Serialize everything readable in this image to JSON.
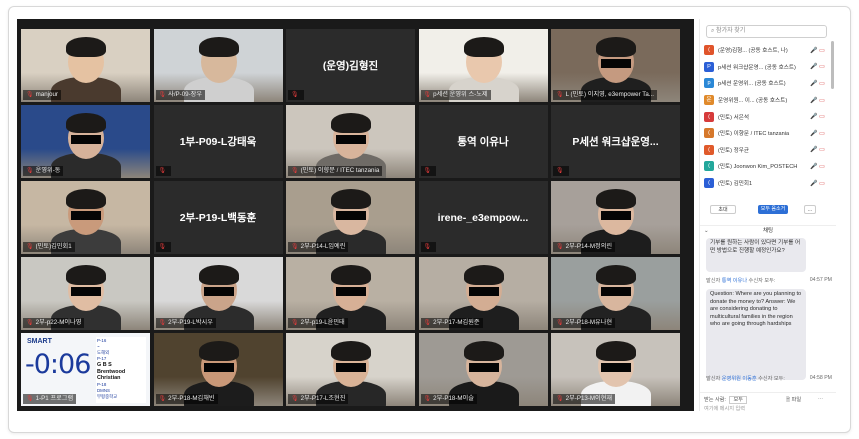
{
  "tiles": [
    {
      "label": "manjour",
      "mic": "on"
    },
    {
      "label": "사/P-09-장우",
      "mic": "off"
    },
    {
      "label": "",
      "center": "(운영)김형진",
      "mic": "off"
    },
    {
      "label": "p세션 운영위 스-노제",
      "mic": "off",
      "active": true
    },
    {
      "label": "L (민토) 이지영, e3empower Ta...",
      "mic": "off"
    },
    {
      "label": "운영위-동",
      "mic": "off"
    },
    {
      "label": "",
      "center": "1부-P09-L강태욱",
      "mic": "off"
    },
    {
      "label": "(민토) 이향문 / ITEC tanzania",
      "mic": "off"
    },
    {
      "label": "",
      "center": "통역 이유나",
      "mic": "off"
    },
    {
      "label": "",
      "center": "P세션 워크샵운영...",
      "mic": "off"
    },
    {
      "label": "(민토)김민회1",
      "mic": "off"
    },
    {
      "label": "",
      "center": "2부-P19-L백동훈",
      "mic": "off"
    },
    {
      "label": "2부-P14-L임예린",
      "mic": "off"
    },
    {
      "label": "",
      "center": "irene-_e3empow...",
      "mic": "off"
    },
    {
      "label": "2부-P14-M정의린",
      "mic": "off"
    },
    {
      "label": "2부-p22-M이나영",
      "mic": "off"
    },
    {
      "label": "2부-P19-L박시우",
      "mic": "off"
    },
    {
      "label": "2부-p19-L윤민태",
      "mic": "off"
    },
    {
      "label": "2부-P17-M김원준",
      "mic": "off"
    },
    {
      "label": "2부-P18-M유나현",
      "mic": "off"
    },
    {
      "label": "1-P1 프로그램",
      "mic": "off",
      "timer": true
    },
    {
      "label": "2부-P18-M김채빈",
      "mic": "off"
    },
    {
      "label": "2부-P17-L조현진",
      "mic": "off"
    },
    {
      "label": "2부-P18-M이슬",
      "mic": "off"
    },
    {
      "label": "2부-P13-M이현재",
      "mic": "off"
    }
  ],
  "timer": {
    "brand": "SMART",
    "countdown": "-0:06",
    "side_lines": [
      "P-16",
      "~",
      "도해외",
      "P-17",
      "G B S",
      "Brentwood Christian",
      "P-18",
      "DMNS",
      "부평중학교"
    ]
  },
  "panel": {
    "search_placeholder": "참가자 찾기",
    "participants": [
      {
        "initial": "(",
        "color": "#e0542b",
        "name": "(운영)김형... (공동 호스트, 나)",
        "mic": "🎤",
        "cam": "▭"
      },
      {
        "initial": "P",
        "color": "#2b5fd6",
        "name": "p세션 워크샵운영... (공동 호스트)",
        "mic": "🎤",
        "cam": "▭"
      },
      {
        "initial": "p",
        "color": "#2b88d6",
        "name": "p세션 운영위... (공동 호스트)",
        "mic": "🎤",
        "cam": "▭"
      },
      {
        "initial": "운",
        "color": "#e08a2b",
        "name": "운영위원... 이... (공동 호스트)",
        "mic": "🎤",
        "cam": "▭"
      },
      {
        "initial": "(",
        "color": "#d63b3b",
        "name": "(민토) 서은석",
        "mic": "🎤",
        "cam": "▭"
      },
      {
        "initial": "(",
        "color": "#d6782b",
        "name": "(민토) 이향문 / ITEC tanzania",
        "mic": "🎤",
        "cam": "▭"
      },
      {
        "initial": "(",
        "color": "#e05a2b",
        "name": "(민토) 정우균",
        "mic": "🎤",
        "cam": "▭"
      },
      {
        "initial": "(",
        "color": "#23a79b",
        "name": "(민토) Joonwon Kim_POSTECH",
        "mic": "🎤",
        "cam": "▭"
      },
      {
        "initial": "(",
        "color": "#2b5fd6",
        "name": "(민토) 김민회1",
        "mic": "🎤",
        "cam": "▭"
      }
    ],
    "invite_label": "초대",
    "mute_all_label": "모두 음소거",
    "more_label": "...",
    "chat_title": "채팅",
    "messages": [
      {
        "text": "기부를 원하는 사람이 있다면 기부를 어떤 방법으로 진행할 예정인가요?",
        "sender_prefix": "발신자",
        "sender": "통역 이유나",
        "target": "수신자 모두:",
        "time": "04:57 PM"
      },
      {
        "text": "Question: Where are you planning to donate the money to? Answer: We are considering donating to multicultural families in the region who are going through hardships",
        "sender_prefix": "발신자",
        "sender": "운영위원 이동훈",
        "target": "수신자 모두:",
        "time": "04:58 PM"
      }
    ],
    "to_label": "받는 사람:",
    "to_value": "모두",
    "file_label": "파일",
    "input_placeholder": "여기에 메시지 입력"
  },
  "colors": {
    "active_border": "#b8d433",
    "accent": "#2d6fd6"
  }
}
